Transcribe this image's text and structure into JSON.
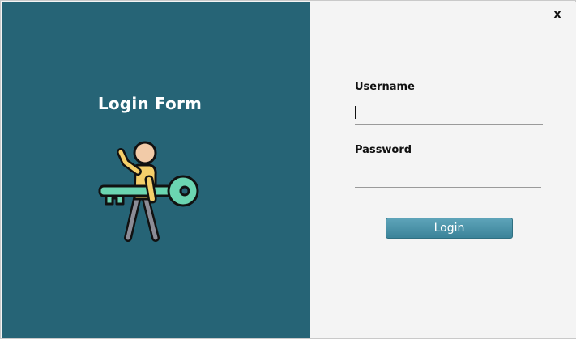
{
  "left_panel": {
    "title": "Login Form",
    "illustration_icon": "person-holding-key-icon",
    "background_color": "#266476"
  },
  "window": {
    "close_label": "x"
  },
  "form": {
    "username_label": "Username",
    "username_value": "",
    "password_label": "Password",
    "password_value": "",
    "login_label": "Login"
  },
  "colors": {
    "accent": "#3b8399",
    "key_green": "#6bd5b1",
    "shirt_yellow": "#f5cf6a",
    "skin": "#f2cba8",
    "pants_gray": "#8c8c96"
  }
}
